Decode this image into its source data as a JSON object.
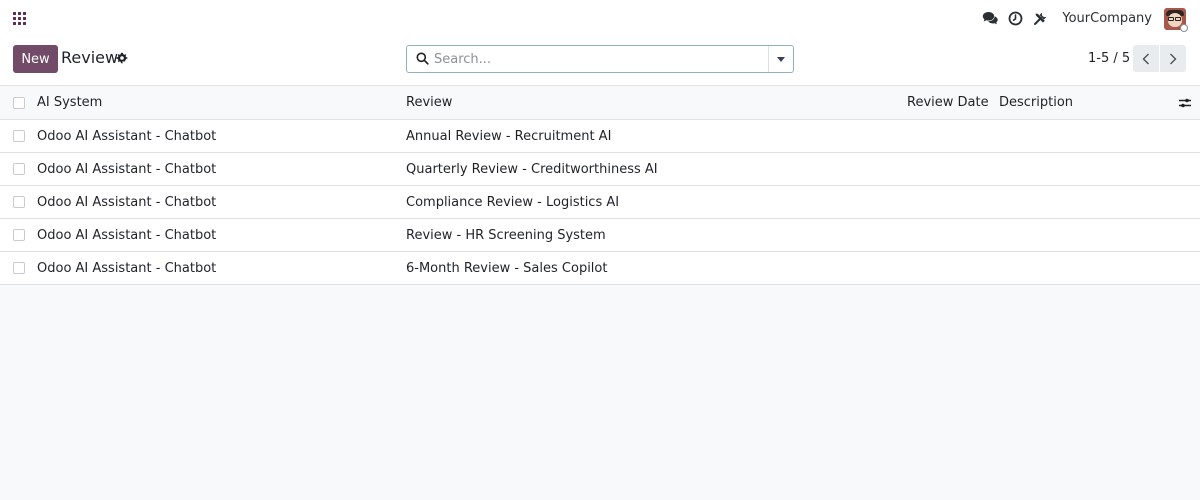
{
  "navbar": {
    "company": "YourCompany",
    "icons": [
      "apps-grid-icon",
      "chat-icon",
      "clock-icon",
      "tools-icon"
    ]
  },
  "control": {
    "new_label": "New",
    "title": "Review",
    "search_placeholder": "Search...",
    "pager": "1-5 / 5"
  },
  "table": {
    "columns": [
      "AI System",
      "Review",
      "Review Date",
      "Description"
    ],
    "rows": [
      {
        "ai_system": "Odoo AI Assistant - Chatbot",
        "review": "Annual Review - Recruitment AI",
        "review_date": "",
        "description": ""
      },
      {
        "ai_system": "Odoo AI Assistant - Chatbot",
        "review": "Quarterly Review - Creditworthiness AI",
        "review_date": "",
        "description": ""
      },
      {
        "ai_system": "Odoo AI Assistant - Chatbot",
        "review": "Compliance Review - Logistics AI",
        "review_date": "",
        "description": ""
      },
      {
        "ai_system": "Odoo AI Assistant - Chatbot",
        "review": "Review - HR Screening System",
        "review_date": "",
        "description": ""
      },
      {
        "ai_system": "Odoo AI Assistant - Chatbot",
        "review": "6-Month Review - Sales Copilot",
        "review_date": "",
        "description": ""
      }
    ]
  },
  "colors": {
    "brand": "#714b67",
    "accent_border": "#8fb3b6"
  }
}
